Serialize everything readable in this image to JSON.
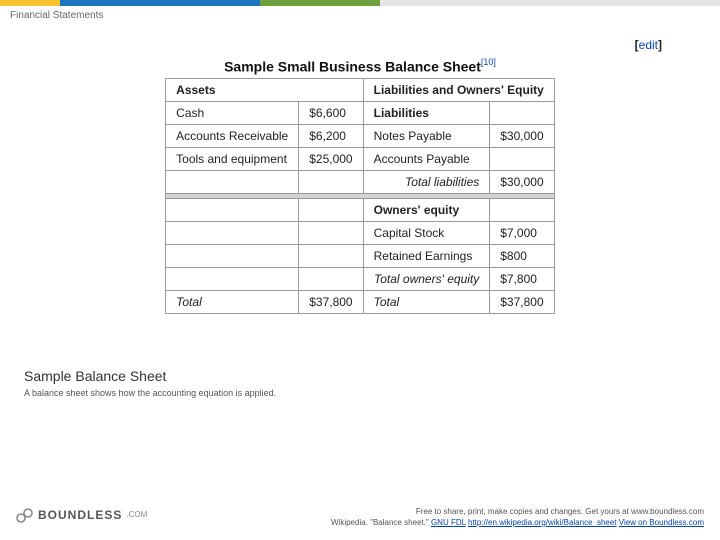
{
  "breadcrumb": "Financial Statements",
  "edit_label": "edit",
  "figure": {
    "title": "Sample Small Business Balance Sheet",
    "cite": "[10]"
  },
  "table": {
    "head": {
      "l": "Assets",
      "r": "Liabilities and Owners' Equity"
    },
    "rows": [
      {
        "l_label": "Cash",
        "l_amt": "$6,600",
        "r_label": "Liabilities",
        "r_bold": true,
        "r_amt": ""
      },
      {
        "l_label": "Accounts Receivable",
        "l_amt": "$6,200",
        "r_label": "Notes Payable",
        "r_bold": false,
        "r_amt": "$30,000"
      },
      {
        "l_label": "Tools and equipment",
        "l_amt": "$25,000",
        "r_label": "Accounts Payable",
        "r_bold": false,
        "r_amt": ""
      },
      {
        "l_label": "",
        "l_amt": "",
        "r_label": "Total liabilities",
        "r_ital": true,
        "r_amt": "$30,000"
      }
    ],
    "owners_header": "Owners' equity",
    "owners": [
      {
        "label": "Capital Stock",
        "amt": "$7,000"
      },
      {
        "label": "Retained Earnings",
        "amt": "$800"
      },
      {
        "label_ital": "Total owners' equity",
        "amt": "$7,800"
      }
    ],
    "totals": {
      "l_label": "Total",
      "l_amt": "$37,800",
      "r_label": "Total",
      "r_amt": "$37,800"
    }
  },
  "caption": {
    "title": "Sample Balance Sheet",
    "desc": "A balance sheet shows how the accounting equation is applied."
  },
  "footer": {
    "logo_text": "BOUNDLESS",
    "logo_com": ".COM",
    "line1": "Free to share, print, make copies and changes. Get yours at www.boundless.com",
    "attr_prefix": "Wikipedia. \"Balance sheet.\" ",
    "license": "GNU FDL",
    "src_url": "http://en.wikipedia.org/wiki/Balance_sheet",
    "view_on": "View on Boundless.com"
  },
  "chart_data": {
    "type": "table",
    "title": "Sample Small Business Balance Sheet",
    "assets": [
      {
        "item": "Cash",
        "value": 6600
      },
      {
        "item": "Accounts Receivable",
        "value": 6200
      },
      {
        "item": "Tools and equipment",
        "value": 25000
      }
    ],
    "assets_total": 37800,
    "liabilities": [
      {
        "item": "Notes Payable",
        "value": 30000
      },
      {
        "item": "Accounts Payable",
        "value": null
      }
    ],
    "total_liabilities": 30000,
    "owners_equity": [
      {
        "item": "Capital Stock",
        "value": 7000
      },
      {
        "item": "Retained Earnings",
        "value": 800
      }
    ],
    "total_owners_equity": 7800,
    "liabilities_and_equity_total": 37800
  }
}
